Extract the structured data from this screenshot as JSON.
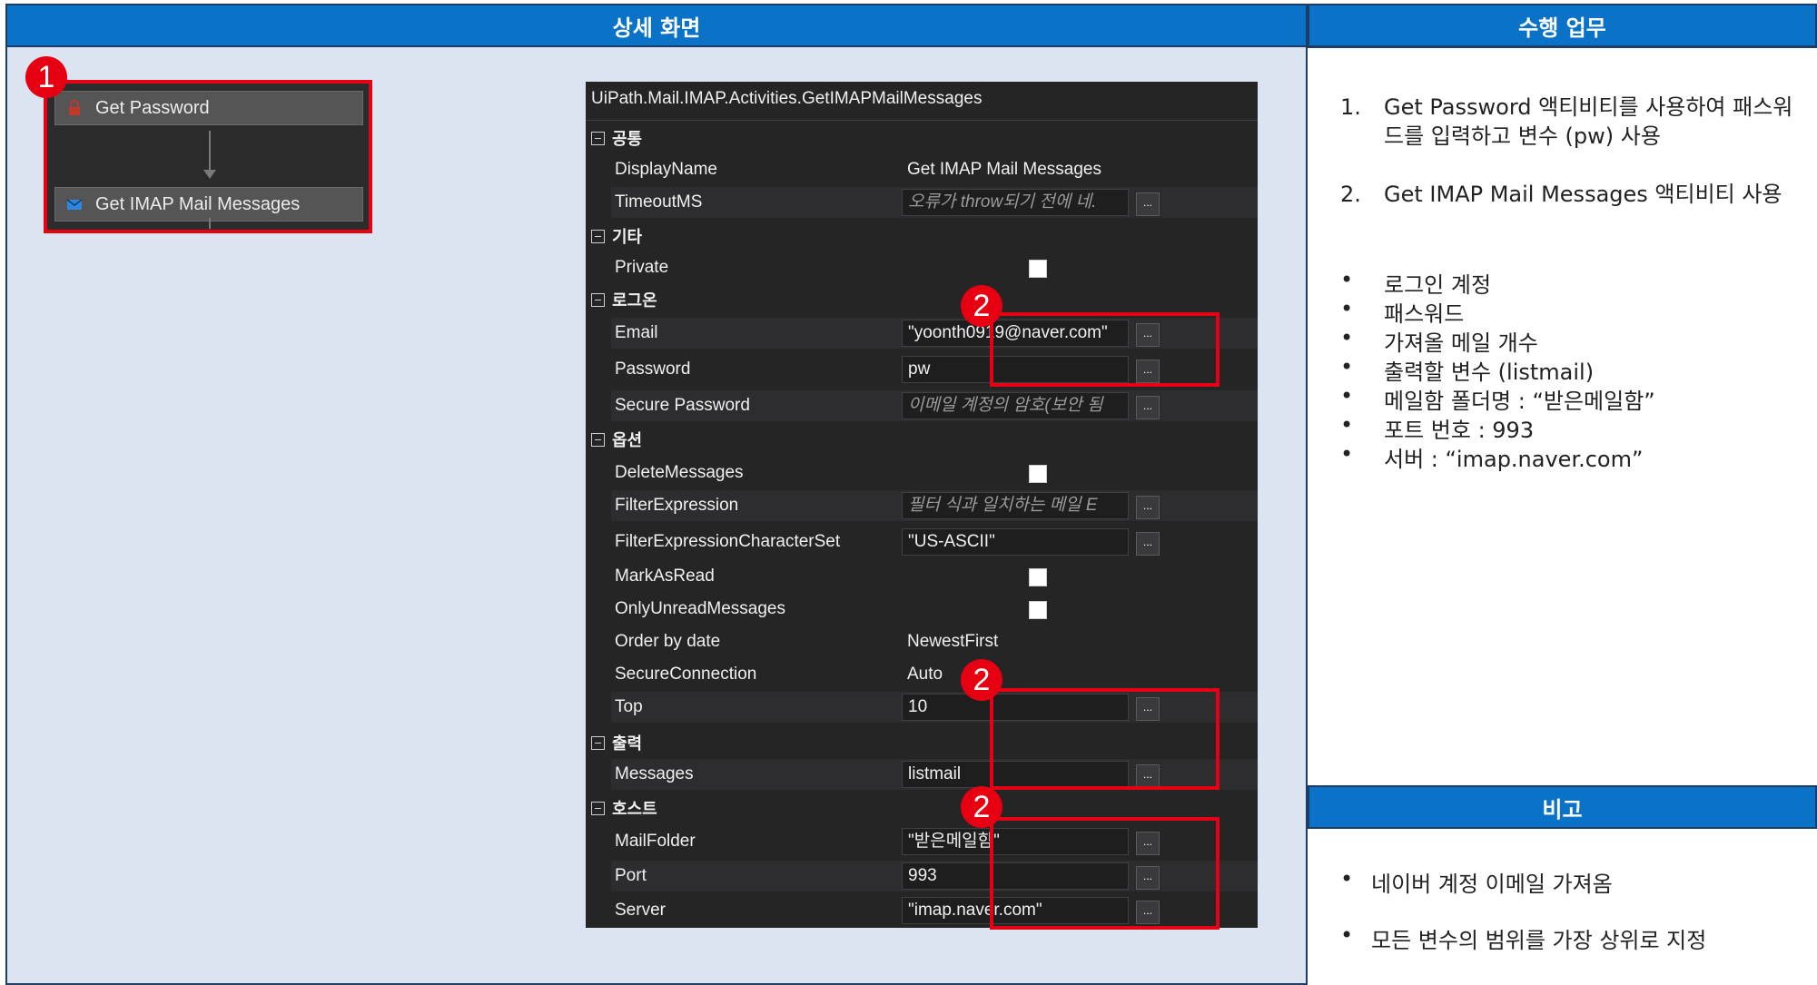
{
  "headers": {
    "detail_screen": "상세 화면",
    "tasks": "수행 업무",
    "notes": "비고"
  },
  "badges": {
    "one": "1",
    "two": "2"
  },
  "workflow": {
    "activities": [
      "Get Password",
      "Get IMAP Mail Messages"
    ]
  },
  "property_grid": {
    "title": "UiPath.Mail.IMAP.Activities.GetIMAPMailMessages",
    "categories": {
      "common": "공통",
      "misc": "기타",
      "logon": "로그온",
      "options": "옵션",
      "output": "출력",
      "host": "호스트"
    },
    "rows": {
      "display_name": {
        "name": "DisplayName",
        "value": "Get IMAP Mail Messages"
      },
      "timeout": {
        "name": "TimeoutMS",
        "value": "오류가 throw되기 전에 네."
      },
      "private": {
        "name": "Private",
        "checked": false
      },
      "email": {
        "name": "Email",
        "value": "\"yoonth0919@naver.com\""
      },
      "password": {
        "name": "Password",
        "value": "pw"
      },
      "secure_password": {
        "name": "Secure Password",
        "value": "이메일 계정의 암호(보안 됨"
      },
      "delete_messages": {
        "name": "DeleteMessages",
        "checked": false
      },
      "filter_expression": {
        "name": "FilterExpression",
        "value": "필터 식과 일치하는 메일 E"
      },
      "filter_charset": {
        "name": "FilterExpressionCharacterSet",
        "value": "\"US-ASCII\""
      },
      "mark_as_read": {
        "name": "MarkAsRead",
        "checked": false
      },
      "only_unread": {
        "name": "OnlyUnreadMessages",
        "checked": false
      },
      "order_by_date": {
        "name": "Order by date",
        "value": "NewestFirst"
      },
      "secure_connection": {
        "name": "SecureConnection",
        "value": "Auto"
      },
      "top": {
        "name": "Top",
        "value": "10"
      },
      "messages": {
        "name": "Messages",
        "value": "listmail"
      },
      "mail_folder": {
        "name": "MailFolder",
        "value": "\"받은메일함\""
      },
      "port": {
        "name": "Port",
        "value": "993"
      },
      "server": {
        "name": "Server",
        "value": "\"imap.naver.com\""
      }
    },
    "ellipsis": "..."
  },
  "tasks": {
    "steps": [
      {
        "num": "1.",
        "text": "Get Password 액티비티를 사용하여 패스워드를 입력하고 변수 (pw) 사용"
      },
      {
        "num": "2.",
        "text": "Get IMAP Mail Messages 액티비티 사용"
      }
    ],
    "bullet": "•",
    "bullets": [
      "로그인 계정",
      "패스워드",
      "가져올 메일 개수",
      "출력할 변수 (listmail)",
      "메일함 폴더명 : “받은메일함”",
      "포트 번호 : 993",
      "서버 : “imap.naver.com”"
    ]
  },
  "notes": {
    "items": [
      "네이버 계정 이메일 가져옴",
      "모든 변수의 범위를 가장 상위로 지정"
    ]
  },
  "colors": {
    "header_blue": "#0a72c7",
    "panel_bg": "#dce4f1",
    "highlight_red": "#e60012",
    "grid_bg": "#252526"
  }
}
